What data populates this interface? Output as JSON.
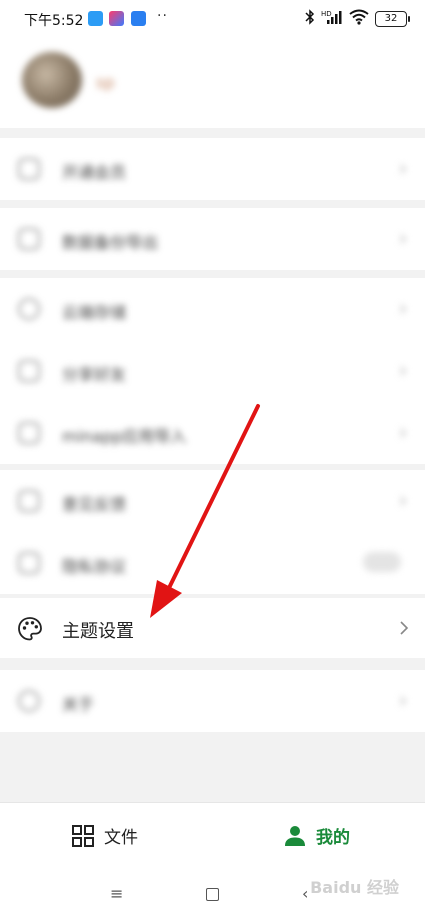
{
  "status_bar": {
    "time": "下午5:52",
    "more": "··",
    "network": "HD",
    "battery": "32"
  },
  "profile": {
    "name": "sp"
  },
  "menu": {
    "items": [
      {
        "label": "开通会员",
        "blurred": true
      },
      {
        "label": "数据备份导出",
        "blurred": true
      },
      {
        "label": "云端存储",
        "blurred": true
      },
      {
        "label": "分享好友",
        "blurred": true
      },
      {
        "label": "minapp应用导入",
        "blurred": true
      },
      {
        "label": "意见反馈",
        "blurred": true
      },
      {
        "label": "隐私协议",
        "blurred": true
      }
    ],
    "theme_settings": "主题设置",
    "about": "关于"
  },
  "bottom_nav": {
    "files": "文件",
    "mine": "我的"
  },
  "watermark": "Baidu 经验",
  "colors": {
    "accent_green": "#1a8a3a",
    "arrow_red": "#e11414"
  }
}
